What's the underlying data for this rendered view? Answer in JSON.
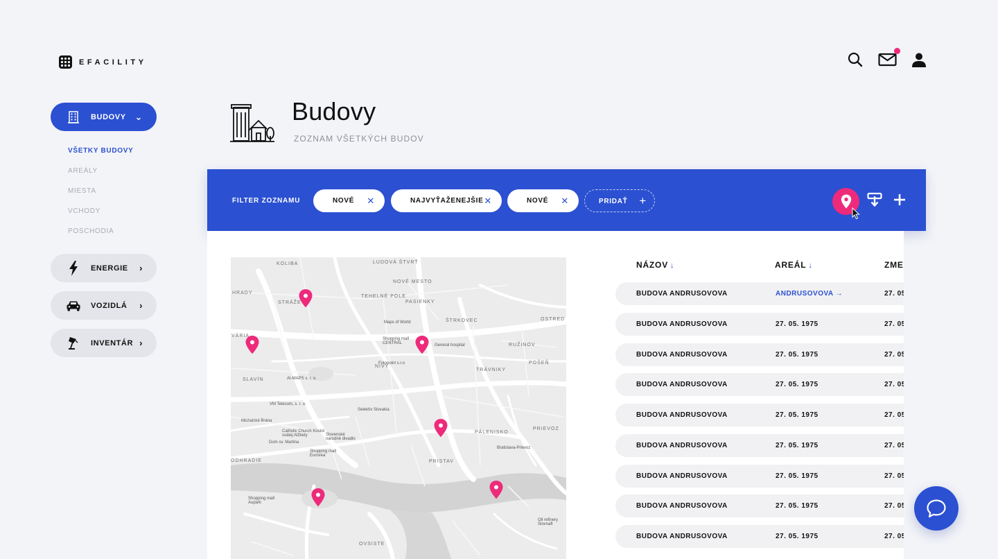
{
  "app": {
    "logo_text": "EFACILITY"
  },
  "topbar": {
    "icons": [
      "search-icon",
      "mail-icon",
      "user-icon"
    ],
    "has_notification": true
  },
  "sidebar": {
    "main_items": [
      {
        "label": "BUDOVY",
        "icon": "building-icon",
        "active": true,
        "chevron": "⌄"
      },
      {
        "label": "ENERGIE",
        "icon": "lightning-icon",
        "active": false,
        "chevron": "›"
      },
      {
        "label": "VOZIDLÁ",
        "icon": "car-icon",
        "active": false,
        "chevron": "›"
      },
      {
        "label": "INVENTÁR",
        "icon": "lamp-icon",
        "active": false,
        "chevron": "›"
      }
    ],
    "sub_items": [
      {
        "label": "VŠETKY BUDOVY",
        "active": true
      },
      {
        "label": "AREÁLY",
        "active": false
      },
      {
        "label": "MIESTA",
        "active": false
      },
      {
        "label": "VCHODY",
        "active": false
      },
      {
        "label": "POSCHODIA",
        "active": false
      }
    ]
  },
  "header": {
    "title": "Budovy",
    "subtitle": "ZOZNAM VŠETKÝCH BUDOV"
  },
  "filter": {
    "label": "FILTER ZOZNAMU",
    "chips": [
      "NOVÉ",
      "NAJVYŤAŽENEJŠIE",
      "NOVÉ"
    ],
    "add_label": "PRIDAŤ"
  },
  "map": {
    "districts": [
      "KOLIBA",
      "LUDOVÁ ŠTVRŤ",
      "NOVÉ MESTO",
      "HRADY",
      "STRÁŽE",
      "TEHELNÉ POLE",
      "PASIENKY",
      "OSTRED",
      "VÁRIA",
      "ŠTRKOVEC",
      "RUŽINOV",
      "POŠEŇ",
      "TRÁVNIKY",
      "SLAVÍN",
      "NIVY",
      "PÁLENISKO",
      "PRIEVOZ",
      "ODHRADIE",
      "PRISTAV",
      "OVSISTE"
    ],
    "places": [
      "Maps of World",
      "Shopping mall CENTRAL",
      "Fotopoint s.r.o",
      "AI-MAPS s. r. o.",
      "Selektív Slovakia",
      "VM Telecom, s. r. o.",
      "Michalská Brána",
      "Catholic Church Kostol svätej Alžbety",
      "Slovenské národné divadlo",
      "Dom sv. Martina",
      "Shopping mall Eurovea",
      "Shopping mall Aupark",
      "Oil refinery Slovnaft",
      "Bratislava-Prievoz",
      "General hospital"
    ]
  },
  "table": {
    "columns": [
      {
        "label": "NÁZOV",
        "sort": "↓"
      },
      {
        "label": "AREÁL",
        "sort": "↓"
      },
      {
        "label": "ZME",
        "sort": ""
      }
    ],
    "rows": [
      [
        "BUDOVA ANDRUSOVOVA",
        "ANDRUSOVOVA →",
        "27. 05"
      ],
      [
        "BUDOVA ANDRUSOVOVA",
        "27. 05. 1975",
        "27. 05"
      ],
      [
        "BUDOVA ANDRUSOVOVA",
        "27. 05. 1975",
        "27. 05"
      ],
      [
        "BUDOVA ANDRUSOVOVA",
        "27. 05. 1975",
        "27. 05"
      ],
      [
        "BUDOVA ANDRUSOVOVA",
        "27. 05. 1975",
        "27. 05"
      ],
      [
        "BUDOVA ANDRUSOVOVA",
        "27. 05. 1975",
        "27. 05"
      ],
      [
        "BUDOVA ANDRUSOVOVA",
        "27. 05. 1975",
        "27. 05"
      ],
      [
        "BUDOVA ANDRUSOVOVA",
        "27. 05. 1975",
        "27. 05"
      ],
      [
        "BUDOVA ANDRUSOVOVA",
        "27. 05. 1975",
        "27. 05"
      ]
    ]
  },
  "colors": {
    "accent": "#2b50d1",
    "pin": "#ee2a7b",
    "background": "#f3f4f8"
  },
  "chat": {
    "icon": "chat-bubble-icon"
  }
}
